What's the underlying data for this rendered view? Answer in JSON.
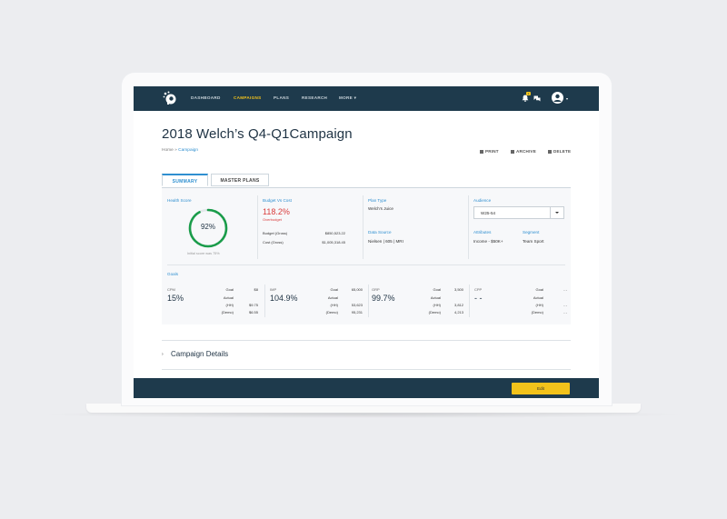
{
  "nav": {
    "items": [
      {
        "label": "DASHBOARD",
        "active": false
      },
      {
        "label": "CAMPAIGNS",
        "active": true
      },
      {
        "label": "PLANS",
        "active": false
      },
      {
        "label": "RESEARCH",
        "active": false
      },
      {
        "label": "MORE",
        "active": false
      }
    ],
    "more_caret": "▾",
    "notification_count": "1",
    "avatar_caret": "▾"
  },
  "page": {
    "title": "2018 Welch’s Q4-Q1Campaign",
    "breadcrumb_home": "Home",
    "breadcrumb_sep": "»",
    "breadcrumb_current": "Campaign"
  },
  "actions": {
    "print": "PRINT",
    "archive": "ARCHIVE",
    "delete": "DELETE"
  },
  "tabs": {
    "summary": "SUMMARY",
    "master": "MASTER PLANS"
  },
  "summary": {
    "health_score_label": "Health Score",
    "health_score": "92%",
    "health_score_fraction": 0.92,
    "initial_score_note": "Initial score was 75%",
    "budget_vs_cost_label": "Budget Vs Cost",
    "budget_vs_cost": "118.2%",
    "overbudget": "Overbudget",
    "budget_gross_label": "Budget (Gross)",
    "budget_gross": "$850,523.22",
    "cost_gross_label": "Cost (Gross)",
    "cost_gross": "$1,005,318.45",
    "plan_type_label": "Plan Type",
    "plan_type": "Welch’s Juice",
    "data_source_label": "Data Source",
    "data_source": "Nielsen | 605 | MRI",
    "audience_label": "Audience",
    "audience_value": "W25-54",
    "attributes_label": "Attributes",
    "attributes": "Income - $50K+",
    "segment_label": "Segment",
    "segment": "Team Sport"
  },
  "goals": {
    "label": "Goals",
    "metrics": [
      {
        "name": "CPM",
        "value": "15%",
        "goal_label": "Goal",
        "goal": "$8",
        "actual_label": "Actual",
        "hh_label": "(HH)",
        "hh": "$9.75",
        "demo_label": "(Demo)",
        "demo": "$6.55"
      },
      {
        "name": "IMP",
        "value": "104.9%",
        "goal_label": "Goal",
        "goal": "65,000",
        "actual_label": "Actual",
        "hh_label": "(HH)",
        "hh": "53,623",
        "demo_label": "(Demo)",
        "demo": "95,231"
      },
      {
        "name": "GRP",
        "value": "99.7%",
        "goal_label": "Goal",
        "goal": "3,500",
        "actual_label": "Actual",
        "hh_label": "(HH)",
        "hh": "3,812",
        "demo_label": "(Demo)",
        "demo": "4,213"
      },
      {
        "name": "CPP",
        "value": "- -",
        "goal_label": "Goal",
        "goal": "- -",
        "actual_label": "Actual",
        "hh_label": "(HH)",
        "hh": "- -",
        "demo_label": "(Demo)",
        "demo": "- -"
      }
    ]
  },
  "campaign_details": {
    "chevron": "›",
    "label": "Campaign Details"
  },
  "footer": {
    "edit": "Edit"
  },
  "colors": {
    "navy": "#1e3a4c",
    "accent": "#f2c21b",
    "link": "#2f8fd0",
    "danger": "#d93b3b",
    "gauge": "#1a9c4a"
  }
}
